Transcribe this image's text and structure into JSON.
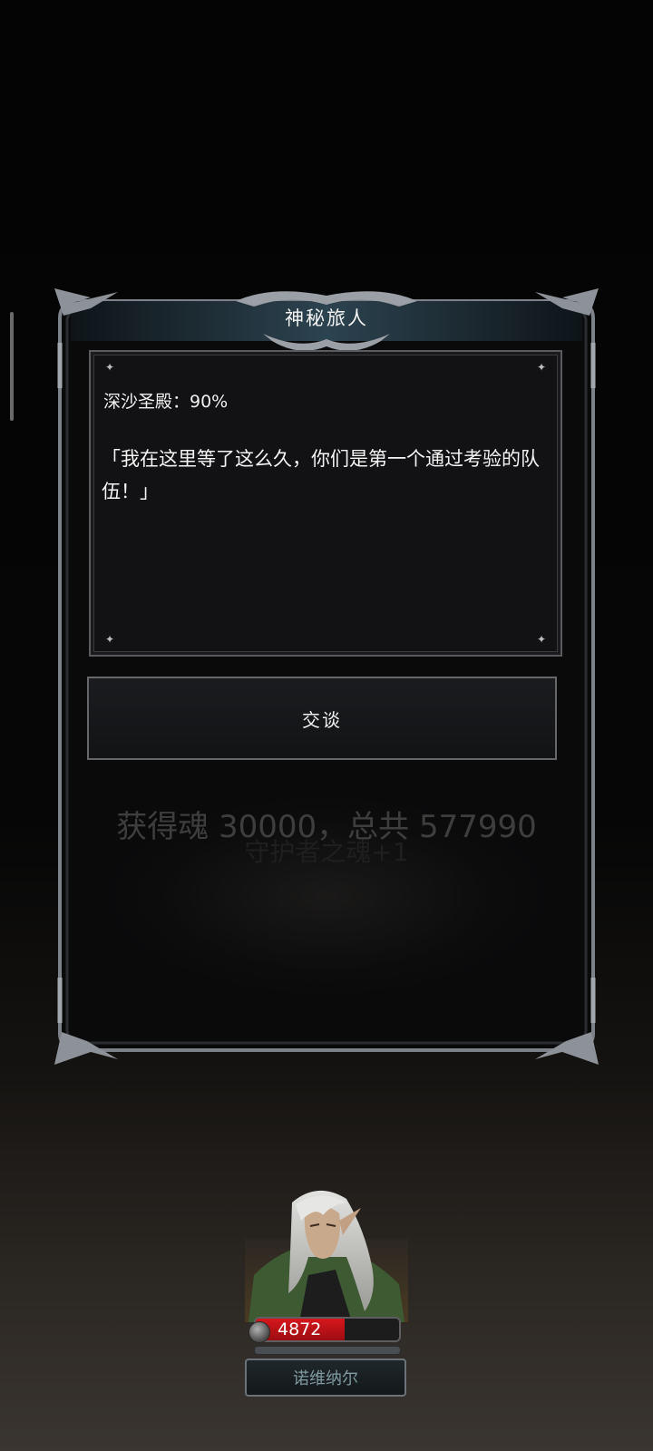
{
  "dialog": {
    "title": "神秘旅人",
    "location": "深沙圣殿：90%",
    "dialogue": "「我在这里等了这么久，你们是第一个通过考验的队伍！」",
    "talk_button_label": "交谈"
  },
  "background_messages": {
    "reward_text": "获得魂 30000，总共 577990",
    "behind_text": "守护者之魂+1"
  },
  "character": {
    "hp": "4872",
    "hp_fraction": 0.62,
    "name": "诺维纳尔"
  },
  "colors": {
    "hp_bar": "#c8141a",
    "frame": "#8a8f96",
    "title_bar": "#2b3f4c"
  },
  "icons": {
    "corner_ornament": "sparkle-icon",
    "hp_icon": "blood-drop-icon"
  }
}
